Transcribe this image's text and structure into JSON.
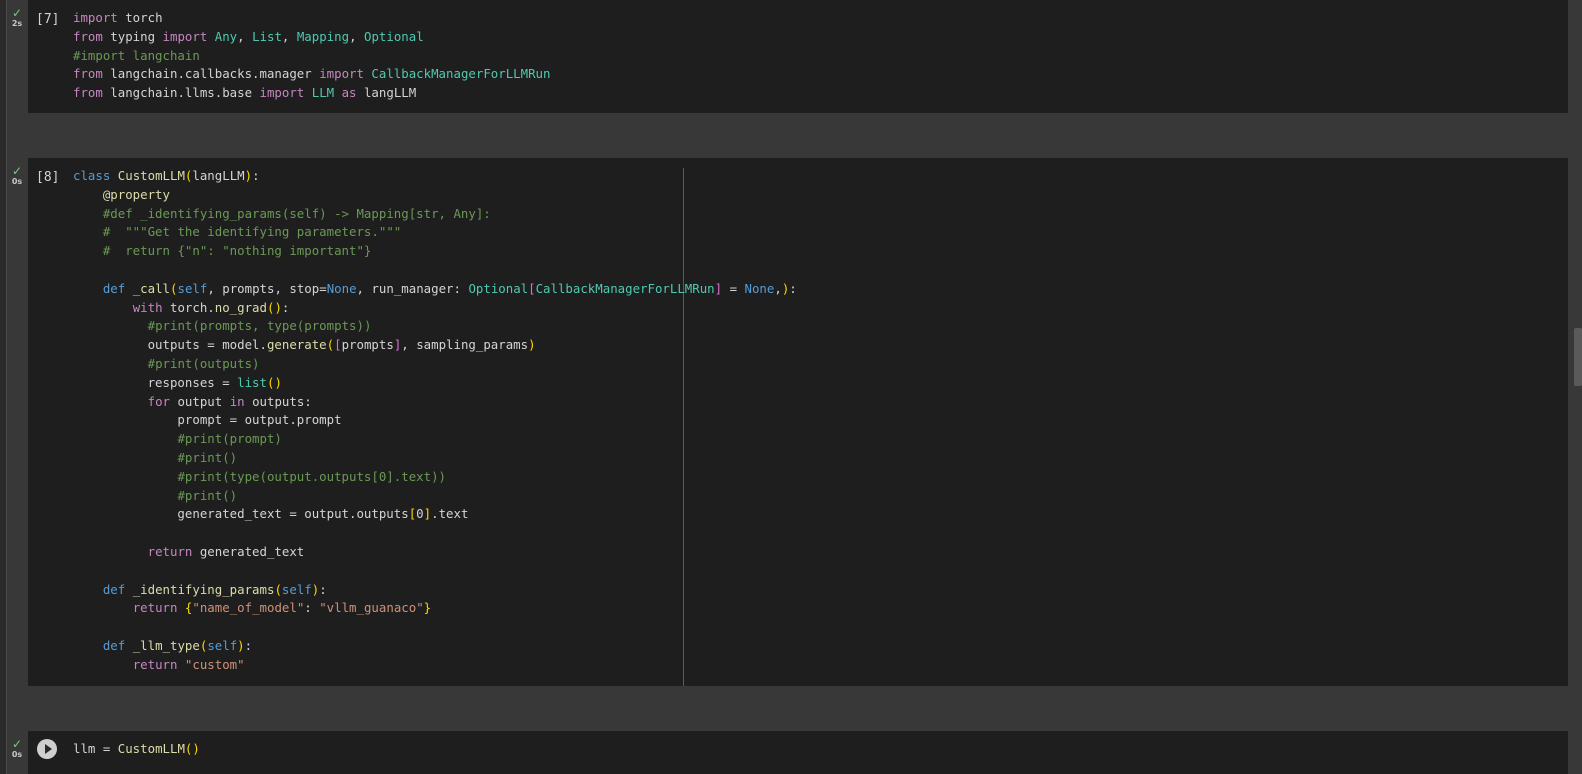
{
  "colors": {
    "background": "#383838",
    "editor": "#1e1e1e",
    "check": "#7ec97e",
    "keyword": "#c586c0",
    "storage": "#569cd6",
    "function": "#dcdcaa",
    "class": "#4ec9b0",
    "comment": "#6a9955",
    "string": "#ce9178",
    "variable": "#9cdcfe",
    "bracket1": "#ffd700",
    "bracket2": "#da70d6",
    "bracket3": "#179fff"
  },
  "icons": {
    "status": "check-icon",
    "run": "play-icon"
  },
  "cells": [
    {
      "exec_label": "[7]",
      "status_time": "2s",
      "code": [
        "import torch",
        "from typing import Any, List, Mapping, Optional",
        "#import langchain",
        "from langchain.callbacks.manager import CallbackManagerForLLMRun",
        "from langchain.llms.base import LLM as langLLM"
      ]
    },
    {
      "exec_label": "[8]",
      "status_time": "0s",
      "code": [
        "class CustomLLM(langLLM):",
        "    @property",
        "    #def _identifying_params(self) -> Mapping[str, Any]:",
        "    #  \"\"\"Get the identifying parameters.\"\"\"",
        "    #  return {\"n\": \"nothing important\"}",
        "",
        "    def _call(self, prompts, stop=None, run_manager: Optional[CallbackManagerForLLMRun] = None,):",
        "        with torch.no_grad():",
        "          #print(prompts, type(prompts))",
        "          outputs = model.generate([prompts], sampling_params)",
        "          #print(outputs)",
        "          responses = list()",
        "          for output in outputs:",
        "              prompt = output.prompt",
        "              #print(prompt)",
        "              #print()",
        "              #print(type(output.outputs[0].text))",
        "              #print()",
        "              generated_text = output.outputs[0].text",
        "",
        "          return generated_text",
        "",
        "    def _identifying_params(self):",
        "        return {\"name_of_model\": \"vllm_guanaco\"}",
        "",
        "    def _llm_type(self):",
        "        return \"custom\""
      ]
    },
    {
      "exec_label": "",
      "status_time": "0s",
      "code": [
        "llm = CustomLLM()"
      ]
    }
  ]
}
